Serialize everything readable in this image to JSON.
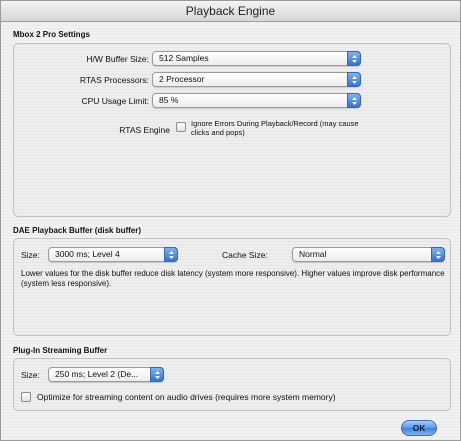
{
  "window": {
    "title": "Playback Engine"
  },
  "mbox": {
    "section_title": "Mbox 2 Pro Settings",
    "hw_buffer": {
      "label": "H/W Buffer Size:",
      "value": "512 Samples"
    },
    "rtas_processors": {
      "label": "RTAS Processors:",
      "value": "2 Processor"
    },
    "cpu_limit": {
      "label": "CPU Usage Limit:",
      "value": "85 %"
    },
    "rtas_engine": {
      "label": "RTAS Engine",
      "checkbox_label": "Ignore Errors During Playback/Record (may cause clicks and pops)",
      "checked": false
    }
  },
  "dae": {
    "section_title": "DAE Playback Buffer (disk buffer)",
    "size": {
      "label": "Size:",
      "value": "3000 ms; Level 4"
    },
    "cache": {
      "label": "Cache Size:",
      "value": "Normal"
    },
    "description": "Lower values for the disk buffer reduce disk latency (system more responsive).  Higher values improve disk performance (system less responsive)."
  },
  "plugin": {
    "section_title": "Plug-In Streaming Buffer",
    "size": {
      "label": "Size:",
      "value": "250 ms; Level 2 (De..."
    },
    "optimize": {
      "label": "Optimize for streaming content on audio drives (requires more system memory)",
      "checked": false
    }
  },
  "buttons": {
    "ok": "OK"
  },
  "colors": {
    "popup_arrow": "#2f74d8",
    "ok_button": "#5c98e6"
  }
}
